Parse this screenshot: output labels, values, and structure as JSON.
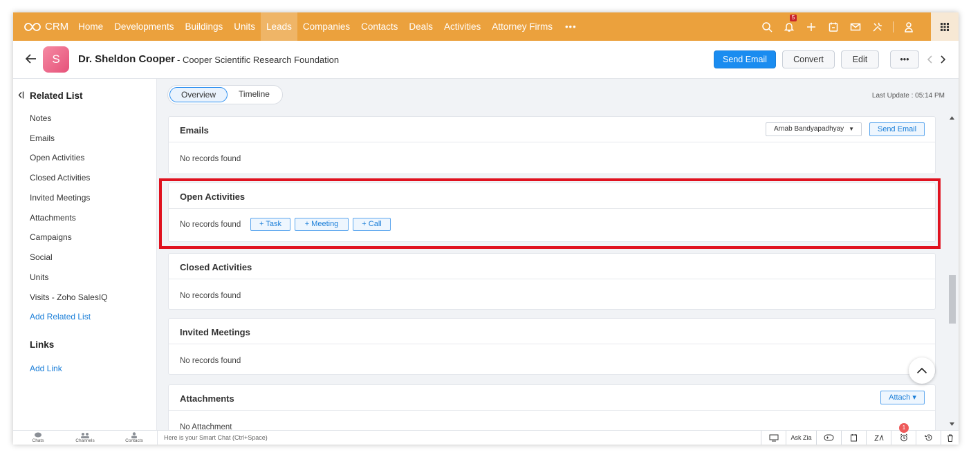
{
  "nav": {
    "logo_text": "CRM",
    "items": [
      "Home",
      "Developments",
      "Buildings",
      "Units",
      "Leads",
      "Companies",
      "Contacts",
      "Deals",
      "Activities",
      "Attorney Firms"
    ],
    "active_item": "Leads",
    "more_label": "•••",
    "notification_count": "5",
    "accent_color": "#eba13d"
  },
  "record": {
    "avatar_letter": "S",
    "name": "Dr. Sheldon Cooper",
    "company": "- Cooper Scientific Research Foundation",
    "buttons": {
      "send_email": "Send Email",
      "convert": "Convert",
      "edit": "Edit",
      "more": "•••"
    }
  },
  "sidebar": {
    "related_title": "Related List",
    "items": [
      "Notes",
      "Emails",
      "Open Activities",
      "Closed Activities",
      "Invited Meetings",
      "Attachments",
      "Campaigns",
      "Social",
      "Units",
      "Visits - Zoho SalesIQ"
    ],
    "add_related": "Add Related List",
    "links_title": "Links",
    "add_link": "Add Link"
  },
  "tabs": {
    "overview": "Overview",
    "timeline": "Timeline",
    "last_update": "Last Update : 05:14 PM"
  },
  "sections": {
    "emails": {
      "title": "Emails",
      "owner": "Arnab Bandyapadhyay",
      "button": "Send Email",
      "body": "No records found"
    },
    "open_activities": {
      "title": "Open Activities",
      "body": "No records found",
      "task": "+ Task",
      "meeting": "+ Meeting",
      "call": "+ Call"
    },
    "closed_activities": {
      "title": "Closed Activities",
      "body": "No records found"
    },
    "invited_meetings": {
      "title": "Invited Meetings",
      "body": "No records found"
    },
    "attachments": {
      "title": "Attachments",
      "button": "Attach ▾",
      "body": "No Attachment"
    }
  },
  "bottombar": {
    "chats": "Chats",
    "channels": "Channels",
    "contacts": "Contacts",
    "smartchat_placeholder": "Here is your Smart Chat (Ctrl+Space)",
    "ask_zia": "Ask Zia",
    "alarm_count": "1"
  }
}
